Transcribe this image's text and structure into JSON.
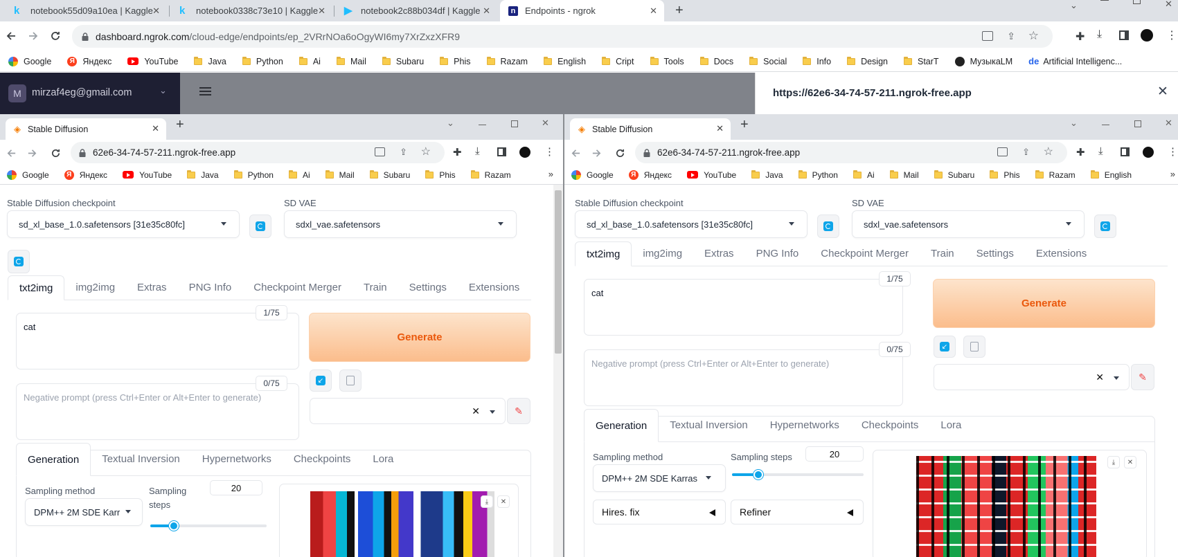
{
  "outer": {
    "tabs": [
      {
        "label": "notebook55d09a10ea | Kaggle",
        "icon": "kaggle-icon"
      },
      {
        "label": "notebook0338c73e10 | Kaggle",
        "icon": "kaggle-icon"
      },
      {
        "label": "notebook2c88b034df | Kaggle",
        "icon": "play-icon"
      },
      {
        "label": "Endpoints - ngrok",
        "icon": "ngrok-icon"
      }
    ],
    "url_host": "dashboard.ngrok.com",
    "url_path": "/cloud-edge/endpoints/ep_2VRrNOa6oOgyWI6my7XrZxzXFR9",
    "bookmarks": [
      {
        "label": "Google",
        "icon": "google"
      },
      {
        "label": "Яндекс",
        "icon": "yandex"
      },
      {
        "label": "YouTube",
        "icon": "youtube"
      },
      {
        "label": "Java",
        "icon": "folder"
      },
      {
        "label": "Python",
        "icon": "folder"
      },
      {
        "label": "Ai",
        "icon": "folder"
      },
      {
        "label": "Mail",
        "icon": "folder"
      },
      {
        "label": "Subaru",
        "icon": "folder"
      },
      {
        "label": "Phis",
        "icon": "folder"
      },
      {
        "label": "Razam",
        "icon": "folder"
      },
      {
        "label": "English",
        "icon": "folder"
      },
      {
        "label": "Cript",
        "icon": "folder"
      },
      {
        "label": "Tools",
        "icon": "folder"
      },
      {
        "label": "Docs",
        "icon": "folder"
      },
      {
        "label": "Social",
        "icon": "folder"
      },
      {
        "label": "Info",
        "icon": "folder"
      },
      {
        "label": "Design",
        "icon": "folder"
      },
      {
        "label": "StarT",
        "icon": "folder"
      },
      {
        "label": "МузыкаLM",
        "icon": "music"
      },
      {
        "label": "Artificial Intelligenc...",
        "icon": "de"
      }
    ],
    "ngrok": {
      "account": "mirzaf4eg@gmail.com",
      "avatar_letter": "M",
      "endpoint_url": "https://62e6-34-74-57-211.ngrok-free.app"
    }
  },
  "sd": {
    "tab_title": "Stable Diffusion",
    "url": "62e6-34-74-57-211.ngrok-free.app",
    "bookmarks_left": [
      "Google",
      "Яндекс",
      "YouTube",
      "Java",
      "Python",
      "Ai",
      "Mail",
      "Subaru",
      "Phis",
      "Razam"
    ],
    "bookmarks_right": [
      "Google",
      "Яндекс",
      "YouTube",
      "Java",
      "Python",
      "Ai",
      "Mail",
      "Subaru",
      "Phis",
      "Razam",
      "English"
    ],
    "checkpoint_label": "Stable Diffusion checkpoint",
    "checkpoint_value": "sd_xl_base_1.0.safetensors [31e35c80fc]",
    "vae_label": "SD VAE",
    "vae_value": "sdxl_vae.safetensors",
    "main_tabs": [
      "txt2img",
      "img2img",
      "Extras",
      "PNG Info",
      "Checkpoint Merger",
      "Train",
      "Settings",
      "Extensions"
    ],
    "prompt": "cat",
    "prompt_count": "1/75",
    "neg_placeholder": "Negative prompt (press Ctrl+Enter or Alt+Enter to generate)",
    "neg_count": "0/75",
    "generate": "Generate",
    "gen_tabs": [
      "Generation",
      "Textual Inversion",
      "Hypernetworks",
      "Checkpoints",
      "Lora"
    ],
    "sampling_method_label": "Sampling method",
    "sampling_method_left": "DPM++ 2M SDE Karr",
    "sampling_method_right": "DPM++ 2M SDE Karras",
    "sampling_steps_label": "Sampling steps",
    "sampling_steps_label_a": "Sampling",
    "sampling_steps_label_b": "steps",
    "sampling_steps": "20",
    "sampling_steps_fraction": 0.2,
    "hires": "Hires. fix",
    "refiner": "Refiner"
  },
  "colors": {
    "accent": "#0ea5e9",
    "generate_text": "#ea580c",
    "ngrok_sidebar": "#1e1f33"
  }
}
